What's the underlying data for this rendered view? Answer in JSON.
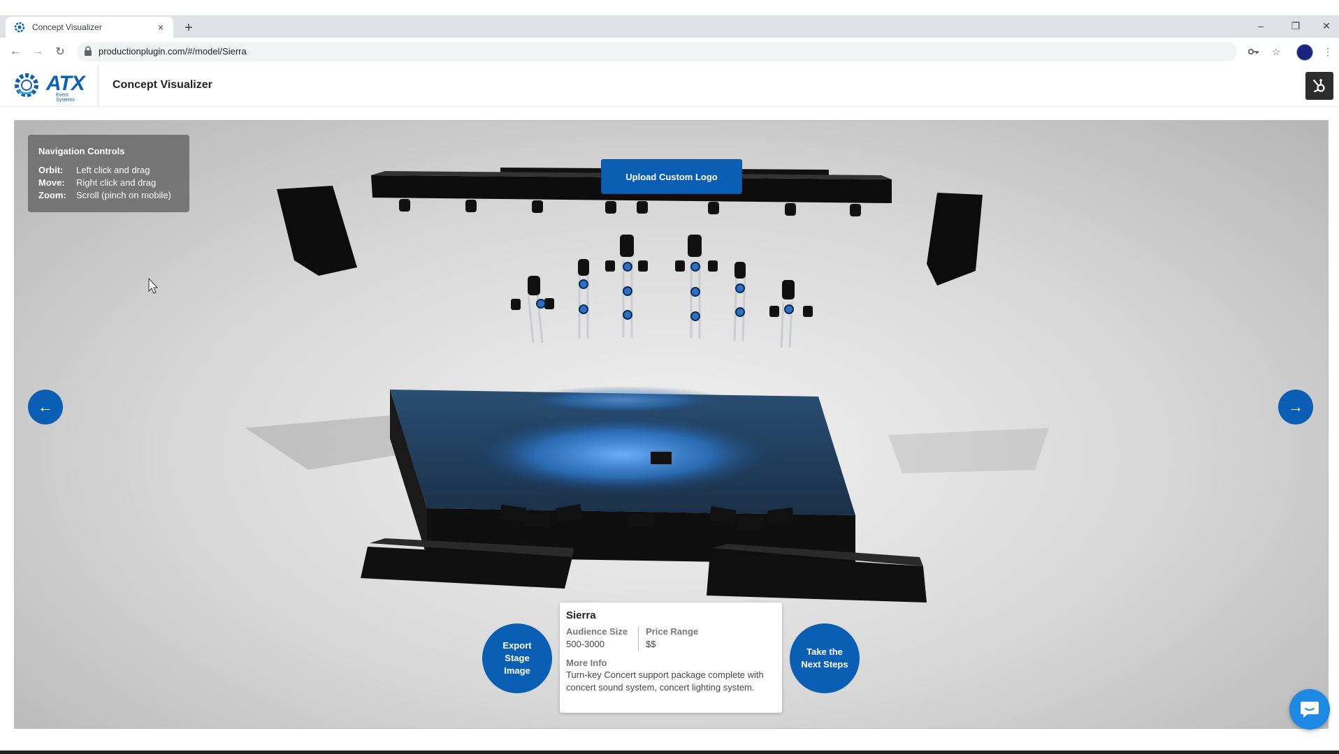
{
  "browser": {
    "tab_title": "Concept Visualizer",
    "tab_close": "×",
    "new_tab": "+",
    "url": "productionplugin.com/#/model/Sierra",
    "window_controls": [
      "–",
      "❐",
      "✕"
    ],
    "nav": {
      "back": "←",
      "forward": "→",
      "reload": "↻"
    }
  },
  "header": {
    "logo_text": "ATX",
    "logo_subtext": "Event Systems",
    "title": "Concept Visualizer",
    "hubspot_icon": "hubspot-sprocket-icon"
  },
  "nav_controls": {
    "title": "Navigation Controls",
    "rows": [
      {
        "key": "Orbit:",
        "value": "Left click and drag"
      },
      {
        "key": "Move:",
        "value": "Right click and drag"
      },
      {
        "key": "Zoom:",
        "value": "Scroll (pinch on mobile)"
      }
    ]
  },
  "upload_button": "Upload Custom Logo",
  "arrows": {
    "prev": "←",
    "next": "→"
  },
  "export_button": "Export Stage Image",
  "next_steps_button": "Take the Next Steps",
  "model": {
    "name": "Sierra",
    "audience_label": "Audience Size",
    "audience_value": "500-3000",
    "price_label": "Price Range",
    "price_value": "$$",
    "more_info_label": "More Info",
    "description": "Turn-key Concert support package complete with concert sound system, concert lighting system."
  },
  "colors": {
    "accent": "#0a5fb4",
    "stage_light": "#3a8ee6",
    "chat": "#1e88e5"
  }
}
